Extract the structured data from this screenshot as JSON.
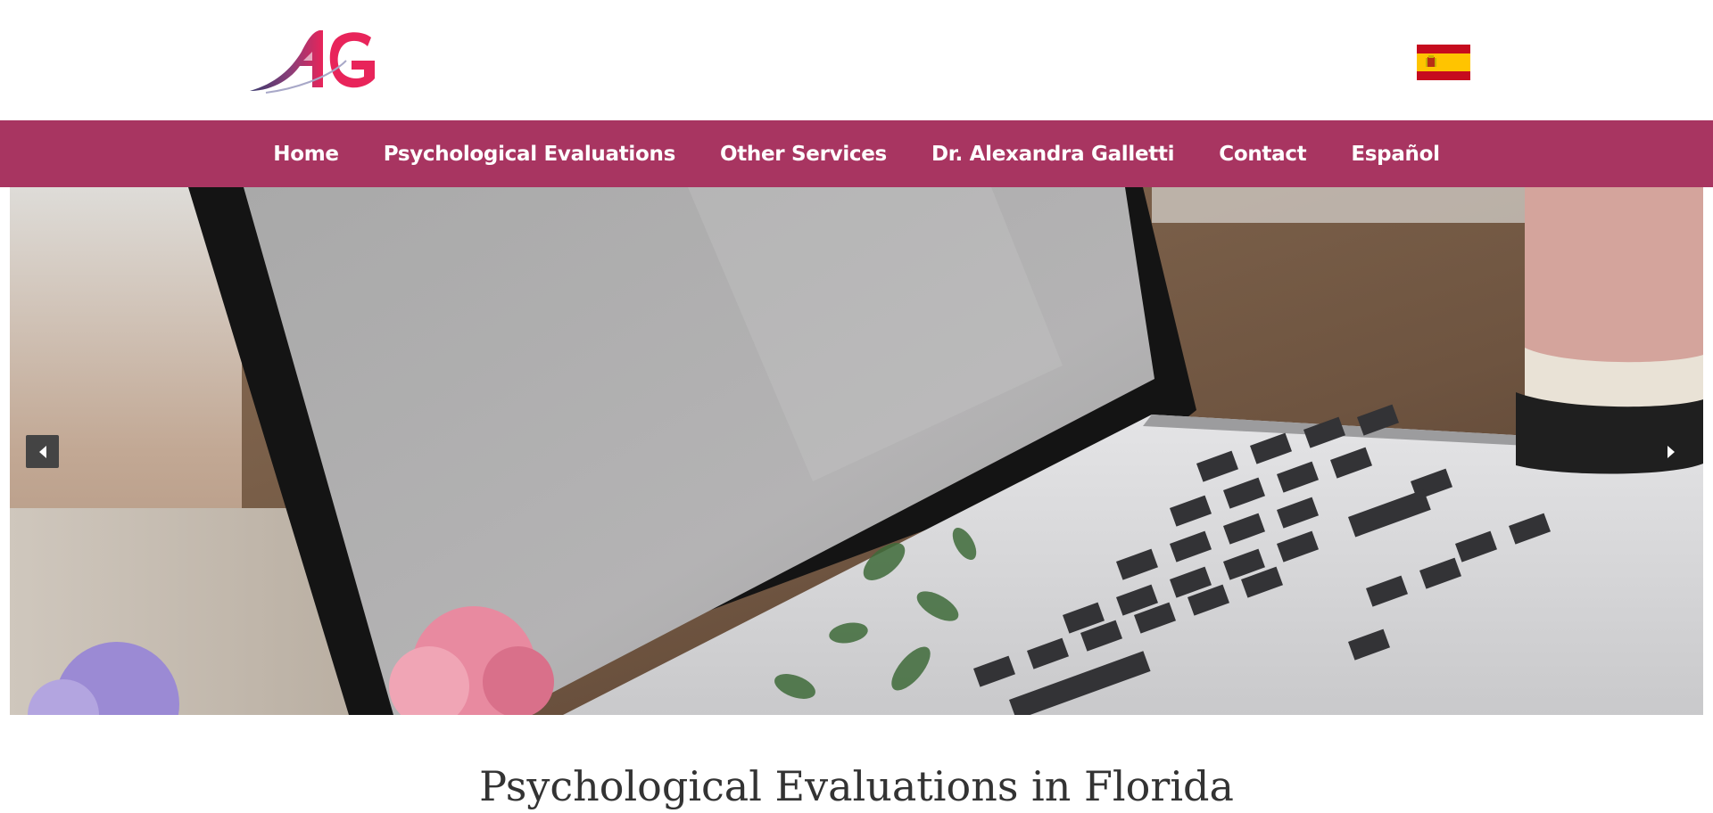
{
  "brand": {
    "logo_text": "AG"
  },
  "language_switch": {
    "flag_icon": "spain-flag-icon"
  },
  "nav": {
    "items": [
      {
        "label": "Home"
      },
      {
        "label": "Psychological Evaluations"
      },
      {
        "label": "Other Services"
      },
      {
        "label": "Dr. Alexandra Galletti"
      },
      {
        "label": "Contact"
      },
      {
        "label": "Español"
      }
    ]
  },
  "slider": {
    "prev_icon": "triangle-left-icon",
    "next_icon": "triangle-right-icon"
  },
  "main": {
    "heading": "Psychological Evaluations in Florida"
  },
  "colors": {
    "nav_bg": "#a83561",
    "text": "#333333",
    "arrow_bg": "#444444"
  }
}
